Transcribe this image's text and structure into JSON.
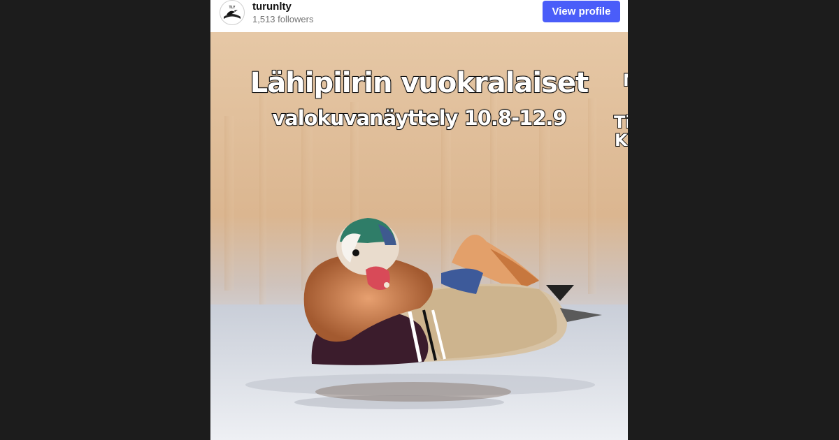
{
  "profile": {
    "username": "turunlty",
    "followers": "1,513 followers",
    "view_profile_label": "View profile",
    "avatar_icon": "bird-logo-icon",
    "avatar_text": "TLY"
  },
  "post": {
    "title": "Lähipiirin vuokralaiset",
    "subtitle": "valokuvanäyttely 10.8-12.9",
    "edge_fragments": [
      "M",
      "Ti",
      "K"
    ]
  },
  "colors": {
    "button": "#4a5df9",
    "background": "#1c1c1c"
  }
}
